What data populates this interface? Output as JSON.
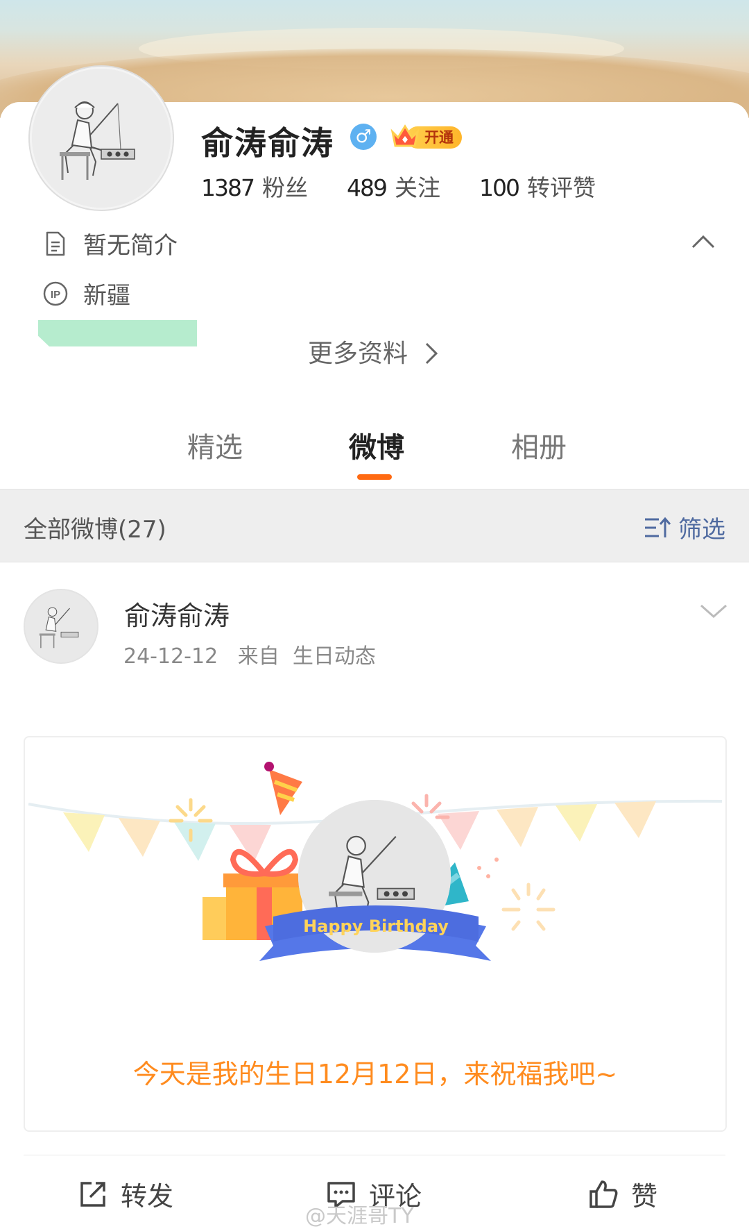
{
  "profile": {
    "name": "俞涛俞涛",
    "gender_symbol": "♂",
    "vip_label": "开通",
    "stats": [
      {
        "num": "1387",
        "label": "粉丝"
      },
      {
        "num": "489",
        "label": "关注"
      },
      {
        "num": "100",
        "label": "转评赞"
      }
    ],
    "bio": "暂无简介",
    "ip_location": "新疆",
    "more_info": "更多资料"
  },
  "tabs": [
    {
      "label": "精选",
      "active": false
    },
    {
      "label": "微博",
      "active": true
    },
    {
      "label": "相册",
      "active": false
    }
  ],
  "filter_bar": {
    "all_label": "全部微博(27)",
    "filter_label": "筛选"
  },
  "post": {
    "author": "俞涛俞涛",
    "meta": "24-12-12   来自  生日动态",
    "card_badge": "Happy Birthday",
    "card_text": "今天是我的生日12月12日，来祝福我吧~"
  },
  "actions": {
    "repost": "转发",
    "comment": "评论",
    "like": "赞"
  },
  "watermark": "@天涯哥TY",
  "colors": {
    "accent_orange": "#ff6a12",
    "birthday_text": "#ff8b1e",
    "filter_blue": "#4f6aa0",
    "gender_blue": "#5eb1f1"
  }
}
